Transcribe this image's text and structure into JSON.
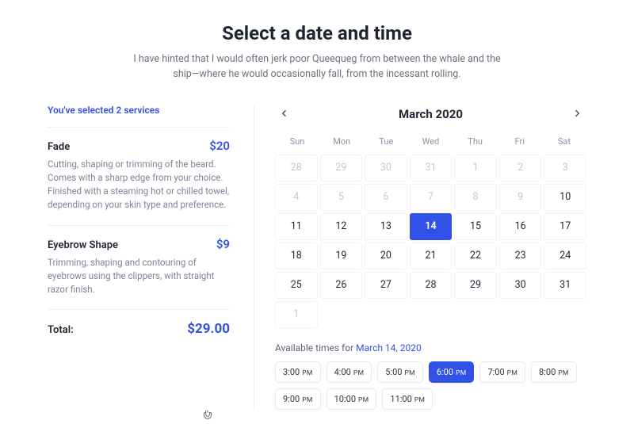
{
  "header": {
    "title": "Select a date and time",
    "subtitle": "I have hinted that I would often jerk poor Queequeg from between the whale and the ship—where he would occasionally fall, from the incessant rolling."
  },
  "summary": {
    "heading": "You've selected 2 services",
    "services": [
      {
        "name": "Fade",
        "price": "$20",
        "desc": "Cutting, shaping or trimming of the beard. Comes with a sharp edge from your choice. Finished with a steaming hot or chilled towel, depending on your skin type and preference."
      },
      {
        "name": "Eyebrow Shape",
        "price": "$9",
        "desc": "Trimming, shaping and contouring of eyebrows using the clippers, with straight razor finish."
      }
    ],
    "total_label": "Total:",
    "total_price": "$29.00"
  },
  "calendar": {
    "month_label": "March 2020",
    "dow": [
      "Sun",
      "Mon",
      "Tue",
      "Wed",
      "Thu",
      "Fri",
      "Sat"
    ],
    "days": [
      {
        "n": 28,
        "out": true
      },
      {
        "n": 29,
        "out": true
      },
      {
        "n": 30,
        "out": true
      },
      {
        "n": 31,
        "out": true
      },
      {
        "n": 1,
        "out": true
      },
      {
        "n": 2,
        "out": true
      },
      {
        "n": 3,
        "out": true
      },
      {
        "n": 4,
        "out": true
      },
      {
        "n": 5,
        "out": true
      },
      {
        "n": 6,
        "out": true
      },
      {
        "n": 7,
        "out": true
      },
      {
        "n": 8,
        "out": true
      },
      {
        "n": 9,
        "out": true
      },
      {
        "n": 10
      },
      {
        "n": 11
      },
      {
        "n": 12
      },
      {
        "n": 13
      },
      {
        "n": 14,
        "sel": true
      },
      {
        "n": 15
      },
      {
        "n": 16
      },
      {
        "n": 17
      },
      {
        "n": 18
      },
      {
        "n": 19
      },
      {
        "n": 20
      },
      {
        "n": 21
      },
      {
        "n": 22
      },
      {
        "n": 23
      },
      {
        "n": 24
      },
      {
        "n": 25
      },
      {
        "n": 26
      },
      {
        "n": 27
      },
      {
        "n": 28
      },
      {
        "n": 29
      },
      {
        "n": 30
      },
      {
        "n": 31
      },
      {
        "n": 1,
        "out": true
      }
    ]
  },
  "availability": {
    "prefix": "Available times for ",
    "date_label": "March 14, 2020",
    "slots": [
      {
        "t": "3:00",
        "p": "PM"
      },
      {
        "t": "4:00",
        "p": "PM"
      },
      {
        "t": "5:00",
        "p": "PM"
      },
      {
        "t": "6:00",
        "p": "PM",
        "sel": true
      },
      {
        "t": "7:00",
        "p": "PM"
      },
      {
        "t": "8:00",
        "p": "PM"
      },
      {
        "t": "9:00",
        "p": "PM"
      },
      {
        "t": "10:00",
        "p": "PM"
      },
      {
        "t": "11:00",
        "p": "PM"
      }
    ]
  }
}
